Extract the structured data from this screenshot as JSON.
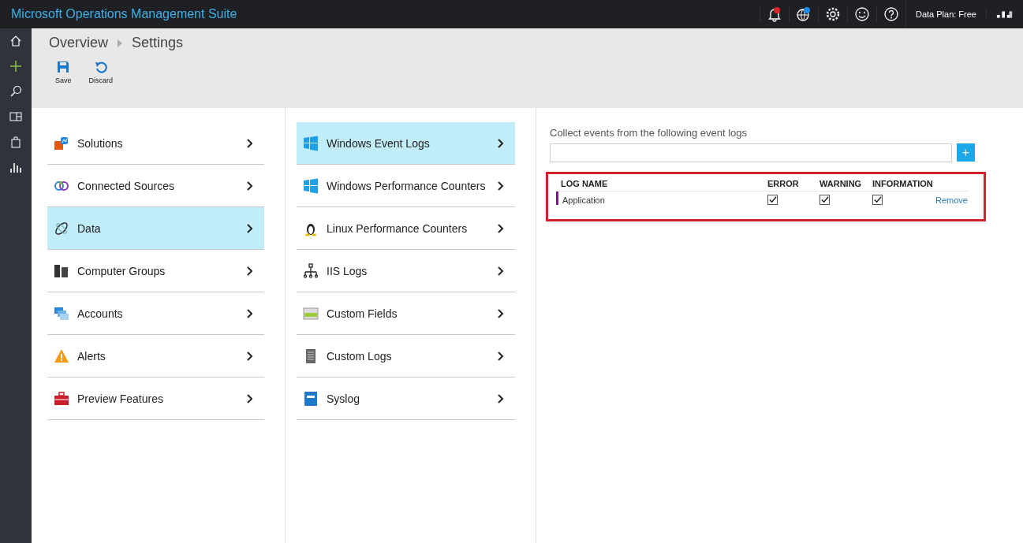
{
  "app": {
    "title": "Microsoft Operations Management Suite",
    "data_plan": "Data Plan: Free"
  },
  "breadcrumb": [
    "Overview",
    "Settings"
  ],
  "toolbar": [
    {
      "label": "Save"
    },
    {
      "label": "Discard"
    }
  ],
  "settings_menu": [
    {
      "label": "Solutions",
      "selected": false
    },
    {
      "label": "Connected Sources",
      "selected": false
    },
    {
      "label": "Data",
      "selected": true
    },
    {
      "label": "Computer Groups",
      "selected": false
    },
    {
      "label": "Accounts",
      "selected": false
    },
    {
      "label": "Alerts",
      "selected": false
    },
    {
      "label": "Preview Features",
      "selected": false
    }
  ],
  "data_menu": [
    {
      "label": "Windows Event Logs",
      "selected": true
    },
    {
      "label": "Windows Performance Counters",
      "selected": false
    },
    {
      "label": "Linux Performance Counters",
      "selected": false
    },
    {
      "label": "IIS Logs",
      "selected": false
    },
    {
      "label": "Custom Fields",
      "selected": false
    },
    {
      "label": "Custom Logs",
      "selected": false
    },
    {
      "label": "Syslog",
      "selected": false
    }
  ],
  "event_logs": {
    "heading": "Collect events from the following event logs",
    "add_button": "+",
    "columns": [
      "LOG NAME",
      "ERROR",
      "WARNING",
      "INFORMATION"
    ],
    "rows": [
      {
        "name": "Application",
        "error": true,
        "warning": true,
        "information": true,
        "action": "Remove"
      }
    ]
  }
}
